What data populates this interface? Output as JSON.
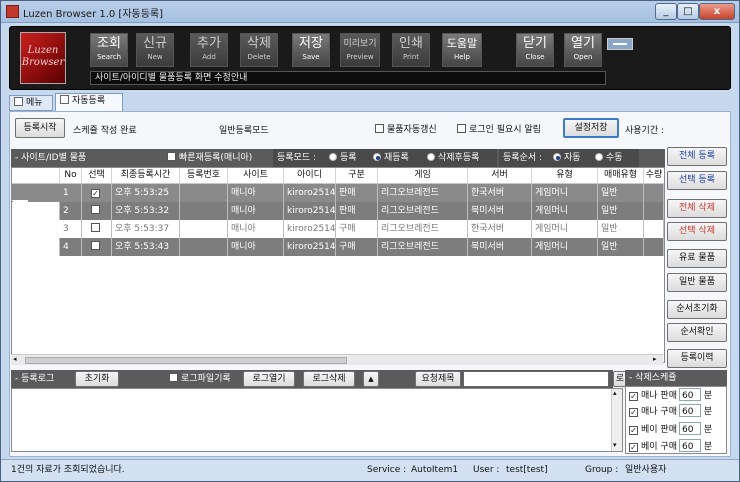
{
  "window": {
    "title": "Luzen Browser 1.0 [자동등록]",
    "min_label": "_",
    "max_label": "□",
    "close_label": "x"
  },
  "logo": {
    "line1": "Luzen",
    "line2": "Browser"
  },
  "toolbar": {
    "buttons": [
      {
        "ko": "조회",
        "en": "Search"
      },
      {
        "ko": "신규",
        "en": "New"
      },
      {
        "ko": "추가",
        "en": "Add"
      },
      {
        "ko": "삭제",
        "en": "Delete"
      },
      {
        "ko": "저장",
        "en": "Save"
      },
      {
        "ko": "미리보기",
        "en": "Preview"
      },
      {
        "ko": "인쇄",
        "en": "Print"
      },
      {
        "ko": "도움말",
        "en": "Help"
      },
      {
        "ko": "닫기",
        "en": "Close"
      },
      {
        "ko": "열기",
        "en": "Open"
      }
    ],
    "address": "사이트/아이디별 물품등록 화면 수정안내"
  },
  "tabs": [
    {
      "label": "메뉴"
    },
    {
      "label": "자동등록"
    }
  ],
  "controls": {
    "start_button": "등록시작",
    "status": "스케쥴 작성 완료",
    "mode": "일반등록모드",
    "auto_update": "물품자동갱신",
    "login_alert": "로그인 필요시 알림",
    "settings_save": "설정저장",
    "usage_period": "사용기간 :"
  },
  "section": {
    "title": "- 사이트/ID별 물품",
    "quick_reg": "빠른재등록(매니아)",
    "reg_mode_label": "등록모드 :",
    "reg_modes": [
      "등록",
      "재등록",
      "삭제후등록"
    ],
    "reg_mode_selected": "재등록",
    "order_label": "등록순서 :",
    "orders": [
      "자동",
      "수동"
    ],
    "order_selected": "자동"
  },
  "grid": {
    "columns": [
      "No",
      "선택",
      "최종등록시간",
      "등록번호",
      "사이트",
      "아이디",
      "구분",
      "게임",
      "서버",
      "유형",
      "매매유형",
      "수량"
    ],
    "rows": [
      {
        "no": "1",
        "checked": true,
        "time": "오후 5:53:25",
        "regno": "",
        "site": "매니아",
        "id": "kiroro2514",
        "type": "판매",
        "game": "리그오브레전드",
        "server": "한국서버",
        "kind": "게임머니",
        "trade": "일반",
        "qty": ""
      },
      {
        "no": "2",
        "checked": false,
        "time": "오후 5:53:32",
        "regno": "",
        "site": "매니아",
        "id": "kiroro2514",
        "type": "판매",
        "game": "리그오브레전드",
        "server": "북미서버",
        "kind": "게임머니",
        "trade": "일반",
        "qty": ""
      },
      {
        "no": "3",
        "checked": false,
        "time": "오후 5:53:37",
        "regno": "",
        "site": "매니아",
        "id": "kiroro2514",
        "type": "구매",
        "game": "리그오브레전드",
        "server": "한국서버",
        "kind": "게임머니",
        "trade": "일반",
        "qty": ""
      },
      {
        "no": "4",
        "checked": false,
        "time": "오후 5:53:43",
        "regno": "",
        "site": "매니아",
        "id": "kiroro2514",
        "type": "구매",
        "game": "리그오브레전드",
        "server": "북미서버",
        "kind": "게임머니",
        "trade": "일반",
        "qty": ""
      }
    ]
  },
  "side_buttons": [
    "전체 등록",
    "선택 등록",
    "전체 삭제",
    "선택 삭제",
    "유료 물품",
    "일반 물품",
    "순서초기화",
    "순서확인",
    "등록이력"
  ],
  "log": {
    "title": "- 등록로그",
    "reset": "초기화",
    "file_log": "로그파일기록",
    "open_log": "로그열기",
    "delete_log": "로그삭제",
    "up": "▲",
    "request_title": "요청제목",
    "small_btn": "로"
  },
  "schedule": {
    "title": "- 삭제스케쥴",
    "items": [
      {
        "label": "매나 판매",
        "value": "60",
        "unit": "분"
      },
      {
        "label": "매나 구매",
        "value": "60",
        "unit": "분"
      },
      {
        "label": "베이 판매",
        "value": "60",
        "unit": "분"
      },
      {
        "label": "베이 구매",
        "value": "60",
        "unit": "분"
      }
    ]
  },
  "statusbar": {
    "message": "1건의 자료가 조회되었습니다.",
    "service_label": "Service :",
    "service": "AutoItem1",
    "user_label": "User :",
    "user": "test[test]",
    "group_label": "Group :",
    "group": "일반사용자"
  }
}
